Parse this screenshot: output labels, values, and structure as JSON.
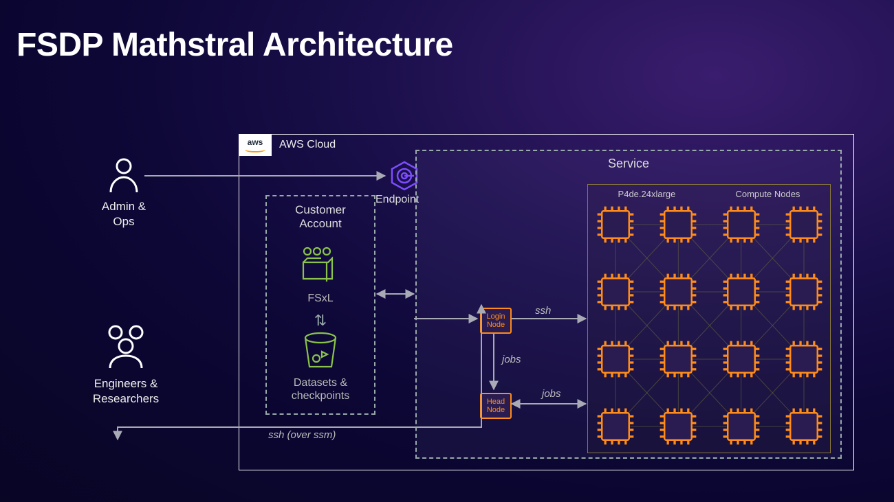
{
  "title": "FSDP Mathstral Architecture",
  "actors": {
    "admin": "Admin &\nOps",
    "engineers": "Engineers &\nResearchers"
  },
  "aws": {
    "logo_text": "aws",
    "cloud_label": "AWS Cloud",
    "endpoint_label": "Endpoint"
  },
  "customer": {
    "box_label": "Customer\nAccount",
    "fsxl": "FSxL",
    "datasets": "Datasets &\ncheckpoints"
  },
  "service": {
    "label": "Service",
    "login_node": "Login\nNode",
    "head_node": "Head\nNode"
  },
  "compute": {
    "instance_type": "P4de.24xlarge",
    "title": "Compute Nodes",
    "rows": 4,
    "cols": 4
  },
  "edges": {
    "ssh_over_ssm": "ssh (over ssm)",
    "ssh": "ssh",
    "jobs_down": "jobs",
    "jobs_right": "jobs"
  },
  "colors": {
    "accent_orange": "#ff8c1a",
    "accent_green": "#8bc34a",
    "accent_purple": "#7c4dff",
    "line": "#a8aab5"
  }
}
